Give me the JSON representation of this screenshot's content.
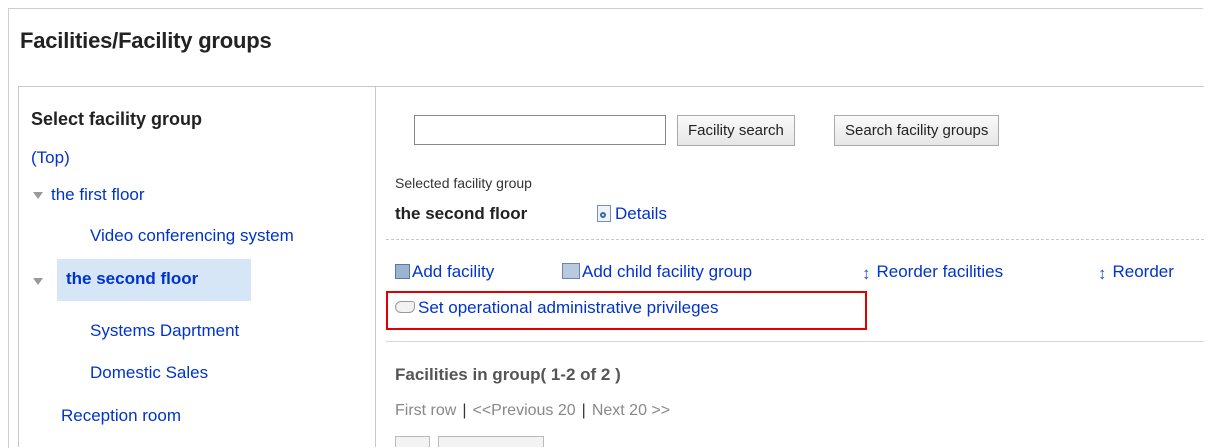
{
  "page_title": "Facilities/Facility groups",
  "tree": {
    "heading": "Select facility group",
    "top_link": "(Top)",
    "nodes": [
      {
        "label": "the first floor"
      },
      {
        "label": "Video conferencing system"
      },
      {
        "label": "the second floor"
      },
      {
        "label": "Systems Daprtment"
      },
      {
        "label": "Domestic Sales"
      },
      {
        "label": "Reception room"
      }
    ]
  },
  "search": {
    "value": "",
    "facility_search_label": "Facility search",
    "group_search_label": "Search facility groups"
  },
  "selected": {
    "label": "Selected facility group",
    "name": "the second floor",
    "details_label": "Details"
  },
  "actions": {
    "add_facility": "Add facility",
    "add_child_group": "Add child facility group",
    "reorder_facilities": "Reorder facilities",
    "reorder_groups": "Reorder",
    "set_privileges": "Set operational administrative privileges"
  },
  "list": {
    "heading": "Facilities in group( 1-2 of 2 )",
    "first_row": "First row",
    "previous": "<<Previous 20",
    "next": "Next 20 >>",
    "separator": "|"
  },
  "colors": {
    "link": "#0033cc",
    "highlight": "#e00000",
    "selected_bg": "#d6e6f7"
  }
}
